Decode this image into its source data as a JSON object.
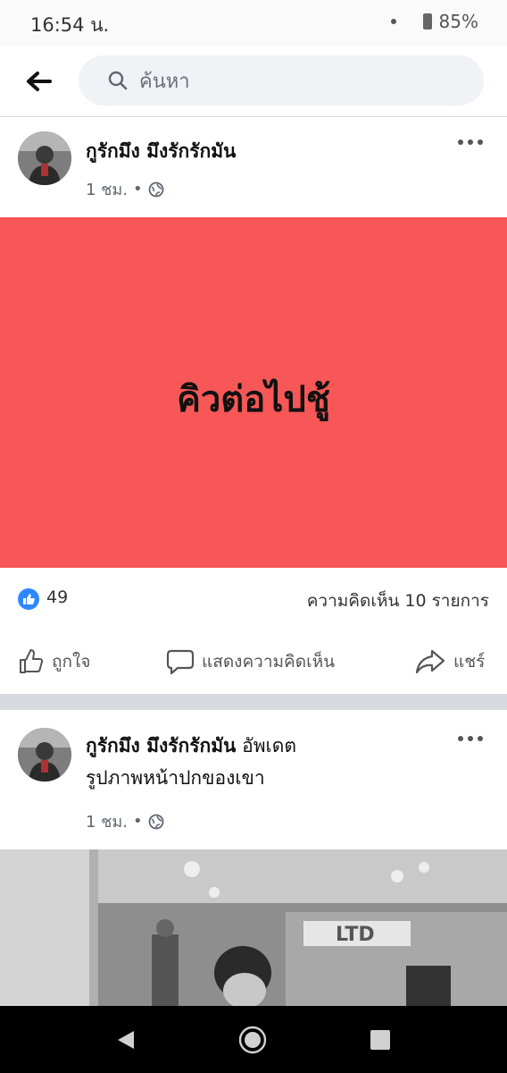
{
  "status_bar": {
    "time": "16:54 น.",
    "battery": "85%"
  },
  "search": {
    "placeholder": "ค้นหา"
  },
  "post1": {
    "author": "กูรักมึง มึงรักรักมัน",
    "time": "1 ชม.",
    "banner_text": "คิวต่อไปชู้",
    "banner_color": "#f75757",
    "like_count": "49",
    "comment_count": "ความคิดเห็น 10 รายการ",
    "actions": {
      "like": "ถูกใจ",
      "comment": "แสดงความคิดเห็น",
      "share": "แชร์"
    }
  },
  "post2": {
    "author": "กูรักมึง มึงรักรักมัน",
    "update_text": "อัพเดต",
    "update_text_2": "รูปภาพหน้าปกของเขา",
    "time": "1 ชม.",
    "photo_sign": "LTD"
  },
  "icons": [
    "back-arrow-icon",
    "search-icon",
    "globe-icon",
    "more-icon",
    "like-icon",
    "comment-icon",
    "share-icon",
    "nav-back-icon",
    "nav-home-icon",
    "nav-recents-icon"
  ]
}
